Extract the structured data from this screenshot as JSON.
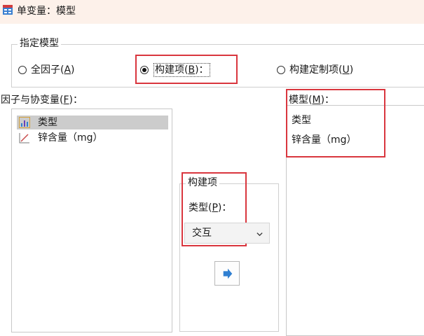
{
  "window": {
    "title": "单变量：模型"
  },
  "specify_model": {
    "group_title": "指定模型",
    "options": [
      {
        "text": "全因子(",
        "mnemonic": "A",
        "suffix": ")",
        "checked": false
      },
      {
        "text": "构建项(",
        "mnemonic": "B",
        "suffix": ")：",
        "checked": true
      },
      {
        "text": "构建定制项(",
        "mnemonic": "U",
        "suffix": ")",
        "checked": false
      }
    ]
  },
  "factors_covariates": {
    "label_text": "因子与协变量(",
    "label_mnemonic": "F",
    "label_suffix": ")：",
    "items": [
      {
        "label": "类型",
        "icon": "nominal-variable-icon",
        "selected": true
      },
      {
        "label": "锌含量（mg）",
        "icon": "scale-variable-icon",
        "selected": false
      }
    ]
  },
  "build_term": {
    "group_title": "构建项",
    "type_label_text": "类型(",
    "type_label_mnemonic": "P",
    "type_label_suffix": ")：",
    "type_value": "交互",
    "move_icon": "arrow-right-icon"
  },
  "model": {
    "label_text": "模型(",
    "label_mnemonic": "M",
    "label_suffix": ")：",
    "items": [
      "类型",
      "锌含量（mg）"
    ]
  }
}
